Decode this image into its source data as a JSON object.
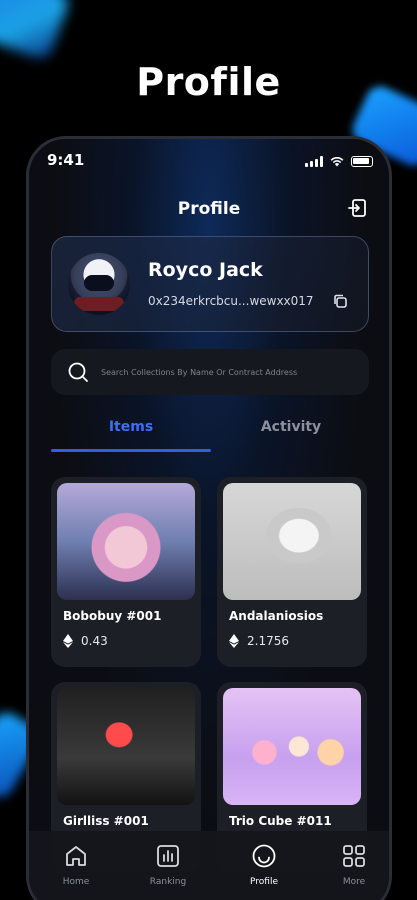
{
  "hero": {
    "title": "Profile"
  },
  "status": {
    "time": "9:41"
  },
  "header": {
    "title": "Profile",
    "logout_icon": "logout-icon"
  },
  "user": {
    "name": "Royco Jack",
    "wallet": "0x234erkrcbcu...wewxx017",
    "copy_icon": "copy-icon"
  },
  "search": {
    "placeholder": "Search Collections By Name Or Contract Address"
  },
  "tabs": [
    {
      "label": "Items",
      "active": true
    },
    {
      "label": "Activity",
      "active": false
    }
  ],
  "items": [
    {
      "name": "Bobobuy #001",
      "price": "0.43"
    },
    {
      "name": "Andalaniosios",
      "price": "2.1756"
    },
    {
      "name": "Girlliss #001",
      "price": ""
    },
    {
      "name": "Trio Cube #011",
      "price": ""
    }
  ],
  "nav": [
    {
      "label": "Home",
      "icon": "home-icon"
    },
    {
      "label": "Ranking",
      "icon": "ranking-icon"
    },
    {
      "label": "Profile",
      "icon": "profile-icon",
      "active": true
    },
    {
      "label": "More",
      "icon": "more-icon"
    }
  ],
  "colors": {
    "accent": "#3d6ef5",
    "background": "#0c0d12",
    "card": "#1d1f26"
  }
}
